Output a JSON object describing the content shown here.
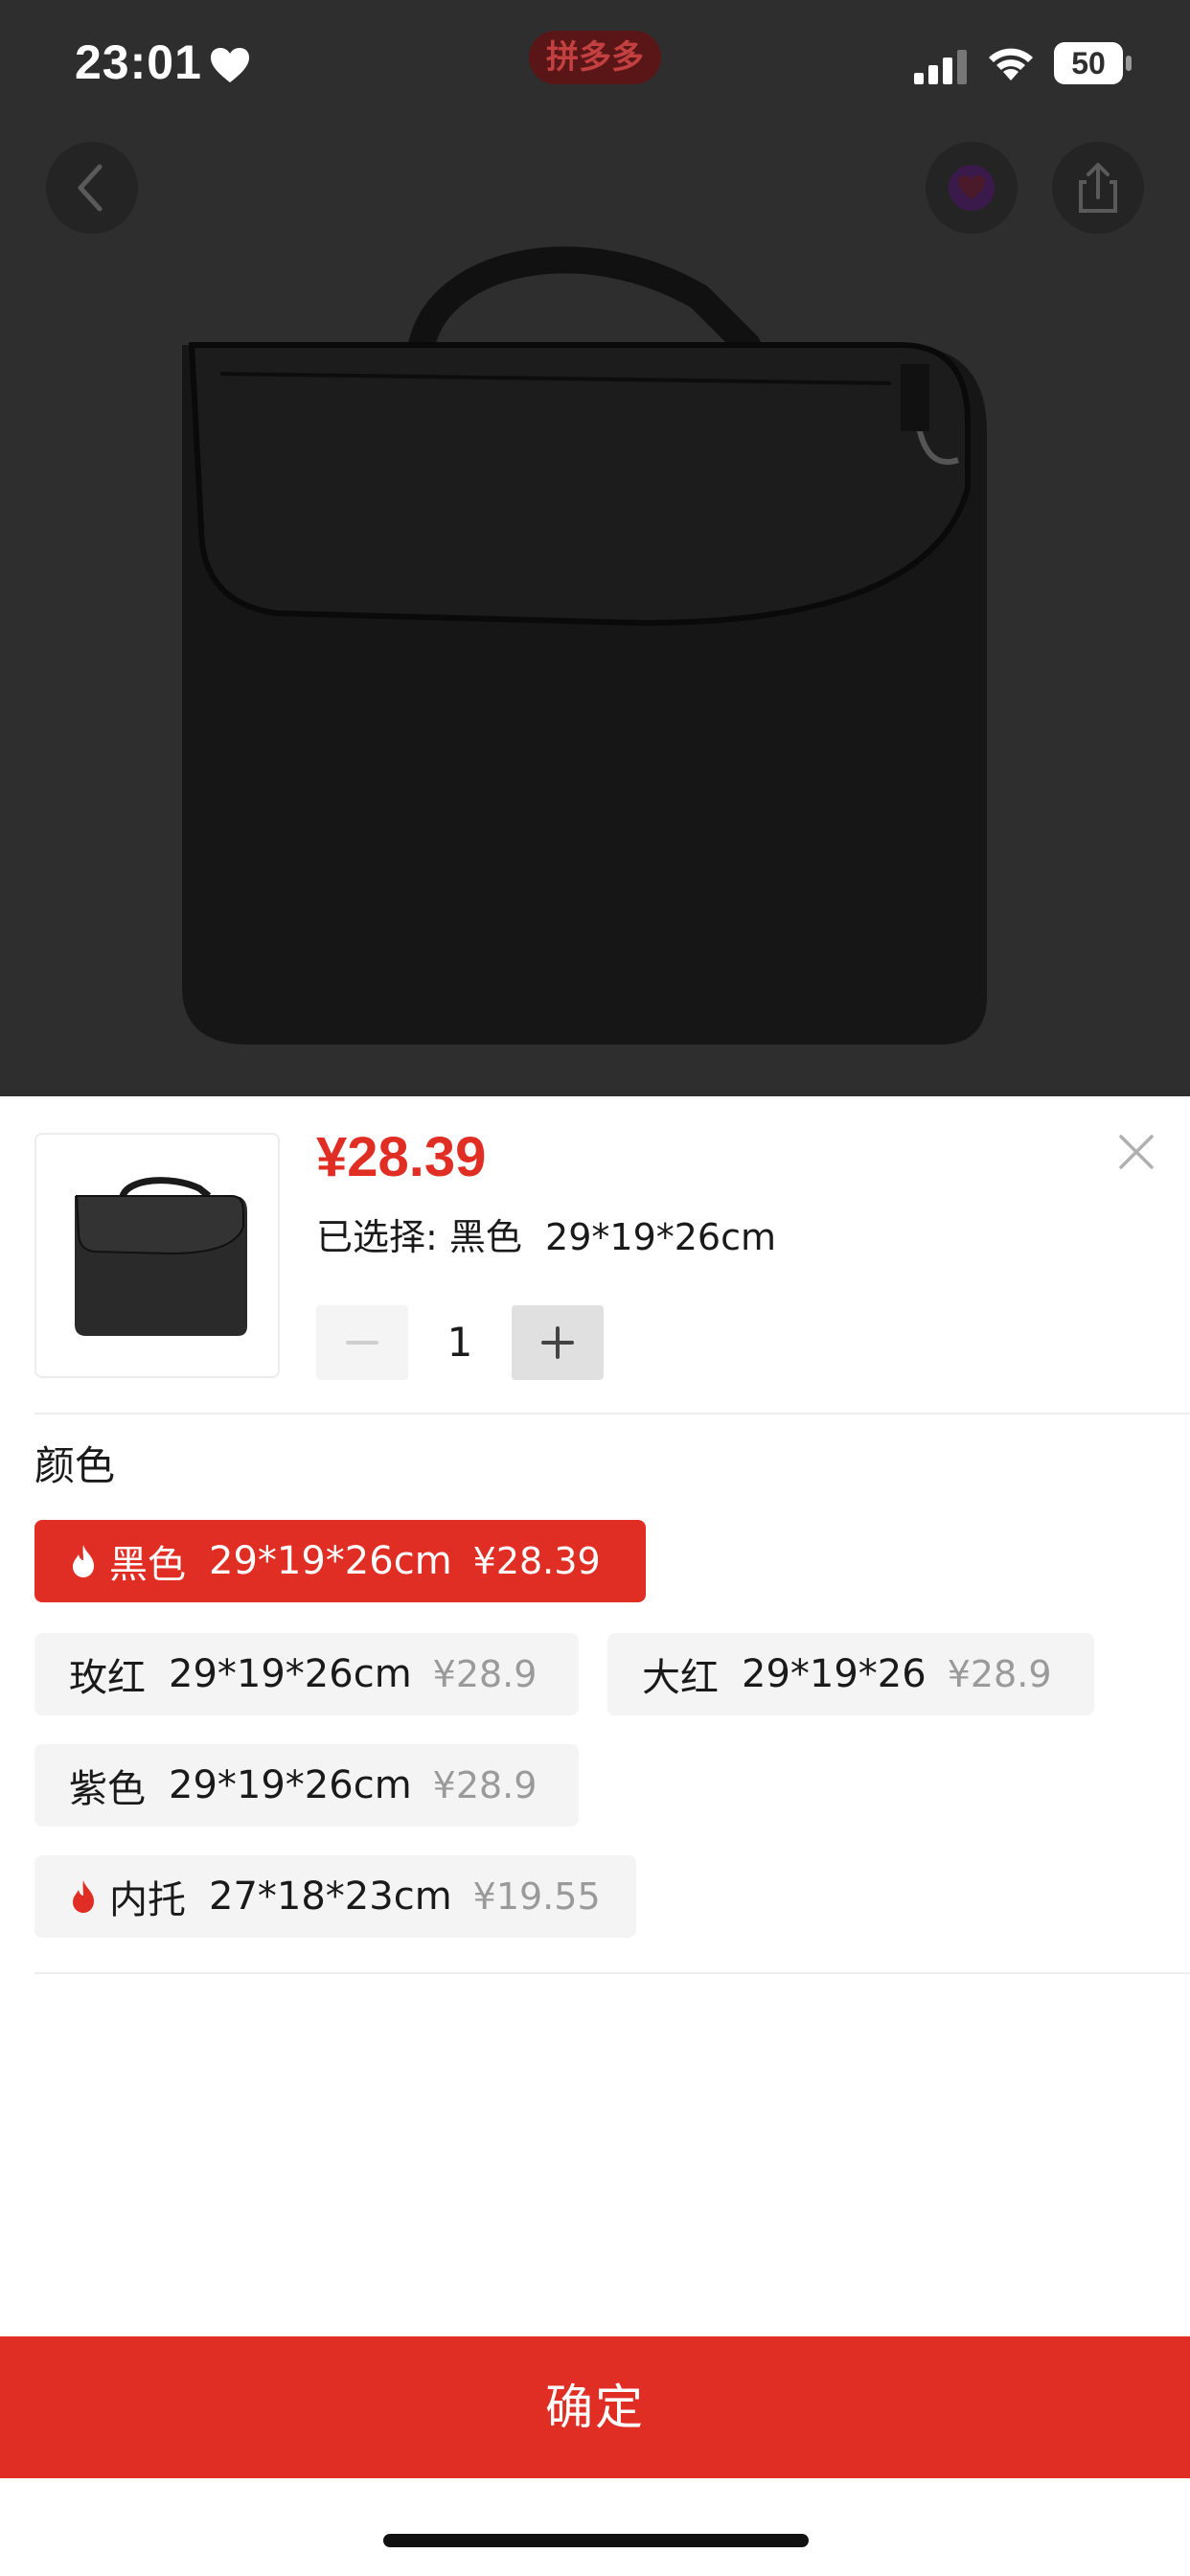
{
  "status_bar": {
    "time": "23:01",
    "app_badge": "拼多多",
    "battery": "50",
    "icons": [
      "heart-icon",
      "signal-icon",
      "wifi-icon",
      "battery-icon"
    ]
  },
  "header": {
    "icons": [
      "back-arrow-icon",
      "favorite-icon",
      "share-icon"
    ]
  },
  "sheet": {
    "price": "¥28.39",
    "selected_label": "已选择: 黑色  29*19*26cm",
    "quantity": "1",
    "section_title": "颜色",
    "options": [
      {
        "name": "黑色",
        "size": "29*19*26cm",
        "price": "¥28.39",
        "hot": true,
        "selected": true
      },
      {
        "name": "玫红",
        "size": "29*19*26cm",
        "price": "¥28.9",
        "hot": false,
        "selected": false
      },
      {
        "name": "大红",
        "size": "29*19*26",
        "price": "¥28.9",
        "hot": false,
        "selected": false
      },
      {
        "name": "紫色",
        "size": "29*19*26cm",
        "price": "¥28.9",
        "hot": false,
        "selected": false
      },
      {
        "name": "内托",
        "size": "27*18*23cm",
        "price": "¥19.55",
        "hot": true,
        "selected": false
      }
    ],
    "confirm_label": "确定"
  },
  "colors": {
    "accent": "#e02e24",
    "overlay": "#2e2e2e",
    "option_bg": "#f4f4f4",
    "muted_price": "#9a9a9a"
  }
}
